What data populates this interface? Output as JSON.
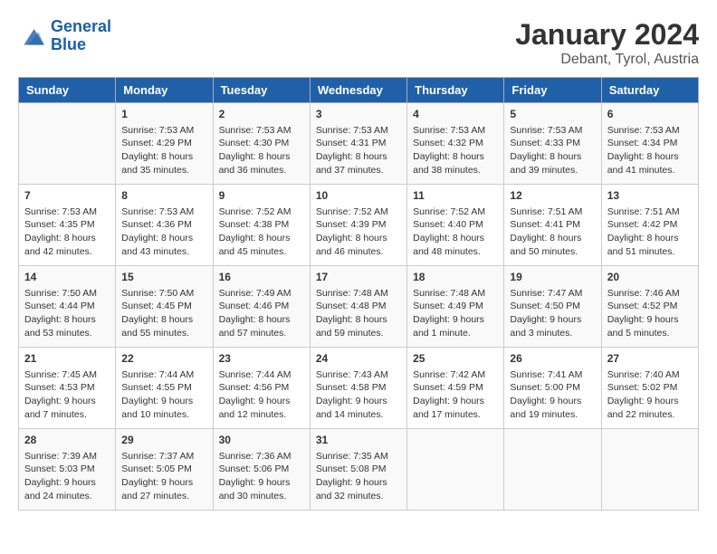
{
  "logo": {
    "text_general": "General",
    "text_blue": "Blue"
  },
  "title": "January 2024",
  "subtitle": "Debant, Tyrol, Austria",
  "days_of_week": [
    "Sunday",
    "Monday",
    "Tuesday",
    "Wednesday",
    "Thursday",
    "Friday",
    "Saturday"
  ],
  "weeks": [
    [
      {
        "day": "",
        "info": ""
      },
      {
        "day": "1",
        "info": "Sunrise: 7:53 AM\nSunset: 4:29 PM\nDaylight: 8 hours\nand 35 minutes."
      },
      {
        "day": "2",
        "info": "Sunrise: 7:53 AM\nSunset: 4:30 PM\nDaylight: 8 hours\nand 36 minutes."
      },
      {
        "day": "3",
        "info": "Sunrise: 7:53 AM\nSunset: 4:31 PM\nDaylight: 8 hours\nand 37 minutes."
      },
      {
        "day": "4",
        "info": "Sunrise: 7:53 AM\nSunset: 4:32 PM\nDaylight: 8 hours\nand 38 minutes."
      },
      {
        "day": "5",
        "info": "Sunrise: 7:53 AM\nSunset: 4:33 PM\nDaylight: 8 hours\nand 39 minutes."
      },
      {
        "day": "6",
        "info": "Sunrise: 7:53 AM\nSunset: 4:34 PM\nDaylight: 8 hours\nand 41 minutes."
      }
    ],
    [
      {
        "day": "7",
        "info": "Sunrise: 7:53 AM\nSunset: 4:35 PM\nDaylight: 8 hours\nand 42 minutes."
      },
      {
        "day": "8",
        "info": "Sunrise: 7:53 AM\nSunset: 4:36 PM\nDaylight: 8 hours\nand 43 minutes."
      },
      {
        "day": "9",
        "info": "Sunrise: 7:52 AM\nSunset: 4:38 PM\nDaylight: 8 hours\nand 45 minutes."
      },
      {
        "day": "10",
        "info": "Sunrise: 7:52 AM\nSunset: 4:39 PM\nDaylight: 8 hours\nand 46 minutes."
      },
      {
        "day": "11",
        "info": "Sunrise: 7:52 AM\nSunset: 4:40 PM\nDaylight: 8 hours\nand 48 minutes."
      },
      {
        "day": "12",
        "info": "Sunrise: 7:51 AM\nSunset: 4:41 PM\nDaylight: 8 hours\nand 50 minutes."
      },
      {
        "day": "13",
        "info": "Sunrise: 7:51 AM\nSunset: 4:42 PM\nDaylight: 8 hours\nand 51 minutes."
      }
    ],
    [
      {
        "day": "14",
        "info": "Sunrise: 7:50 AM\nSunset: 4:44 PM\nDaylight: 8 hours\nand 53 minutes."
      },
      {
        "day": "15",
        "info": "Sunrise: 7:50 AM\nSunset: 4:45 PM\nDaylight: 8 hours\nand 55 minutes."
      },
      {
        "day": "16",
        "info": "Sunrise: 7:49 AM\nSunset: 4:46 PM\nDaylight: 8 hours\nand 57 minutes."
      },
      {
        "day": "17",
        "info": "Sunrise: 7:48 AM\nSunset: 4:48 PM\nDaylight: 8 hours\nand 59 minutes."
      },
      {
        "day": "18",
        "info": "Sunrise: 7:48 AM\nSunset: 4:49 PM\nDaylight: 9 hours\nand 1 minute."
      },
      {
        "day": "19",
        "info": "Sunrise: 7:47 AM\nSunset: 4:50 PM\nDaylight: 9 hours\nand 3 minutes."
      },
      {
        "day": "20",
        "info": "Sunrise: 7:46 AM\nSunset: 4:52 PM\nDaylight: 9 hours\nand 5 minutes."
      }
    ],
    [
      {
        "day": "21",
        "info": "Sunrise: 7:45 AM\nSunset: 4:53 PM\nDaylight: 9 hours\nand 7 minutes."
      },
      {
        "day": "22",
        "info": "Sunrise: 7:44 AM\nSunset: 4:55 PM\nDaylight: 9 hours\nand 10 minutes."
      },
      {
        "day": "23",
        "info": "Sunrise: 7:44 AM\nSunset: 4:56 PM\nDaylight: 9 hours\nand 12 minutes."
      },
      {
        "day": "24",
        "info": "Sunrise: 7:43 AM\nSunset: 4:58 PM\nDaylight: 9 hours\nand 14 minutes."
      },
      {
        "day": "25",
        "info": "Sunrise: 7:42 AM\nSunset: 4:59 PM\nDaylight: 9 hours\nand 17 minutes."
      },
      {
        "day": "26",
        "info": "Sunrise: 7:41 AM\nSunset: 5:00 PM\nDaylight: 9 hours\nand 19 minutes."
      },
      {
        "day": "27",
        "info": "Sunrise: 7:40 AM\nSunset: 5:02 PM\nDaylight: 9 hours\nand 22 minutes."
      }
    ],
    [
      {
        "day": "28",
        "info": "Sunrise: 7:39 AM\nSunset: 5:03 PM\nDaylight: 9 hours\nand 24 minutes."
      },
      {
        "day": "29",
        "info": "Sunrise: 7:37 AM\nSunset: 5:05 PM\nDaylight: 9 hours\nand 27 minutes."
      },
      {
        "day": "30",
        "info": "Sunrise: 7:36 AM\nSunset: 5:06 PM\nDaylight: 9 hours\nand 30 minutes."
      },
      {
        "day": "31",
        "info": "Sunrise: 7:35 AM\nSunset: 5:08 PM\nDaylight: 9 hours\nand 32 minutes."
      },
      {
        "day": "",
        "info": ""
      },
      {
        "day": "",
        "info": ""
      },
      {
        "day": "",
        "info": ""
      }
    ]
  ]
}
